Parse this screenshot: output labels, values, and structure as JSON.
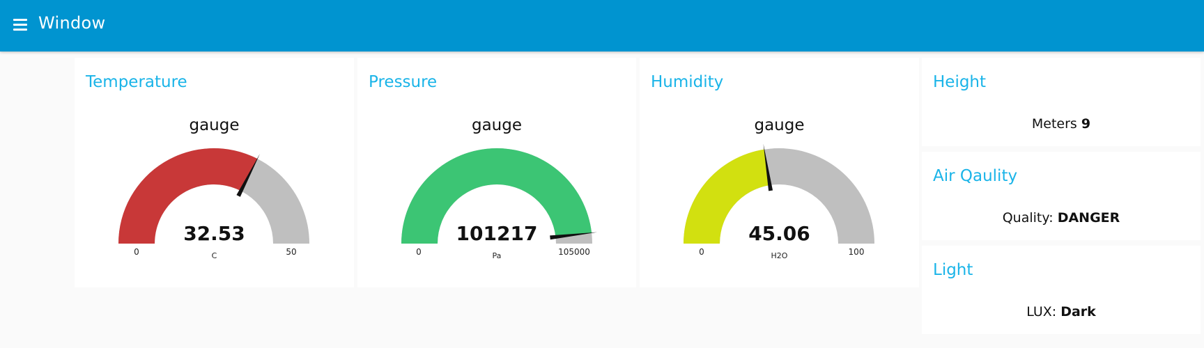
{
  "app": {
    "title": "Window"
  },
  "gauges": [
    {
      "title": "Temperature",
      "label": "gauge",
      "value": 32.53,
      "value_text": "32.53",
      "min": 0,
      "max": 50,
      "min_text": "0",
      "max_text": "50",
      "unit": "C",
      "color": "#c83838"
    },
    {
      "title": "Pressure",
      "label": "gauge",
      "value": 101217,
      "value_text": "101217",
      "min": 0,
      "max": 105000,
      "min_text": "0",
      "max_text": "105000",
      "unit": "Pa",
      "color": "#3cc574"
    },
    {
      "title": "Humidity",
      "label": "gauge",
      "value": 45.06,
      "value_text": "45.06",
      "min": 0,
      "max": 100,
      "min_text": "0",
      "max_text": "100",
      "unit": "H2O",
      "color": "#d2e010"
    }
  ],
  "texts": [
    {
      "title": "Height",
      "label": "Meters",
      "value": "9"
    },
    {
      "title": "Air Qaulity",
      "label": "Quality:",
      "value": "DANGER"
    },
    {
      "title": "Light",
      "label": "LUX:",
      "value": "Dark"
    }
  ],
  "colors": {
    "header": "#0094d0",
    "card_title": "#1ab4e8",
    "gauge_track": "#bfbfbf",
    "needle": "#111111"
  }
}
